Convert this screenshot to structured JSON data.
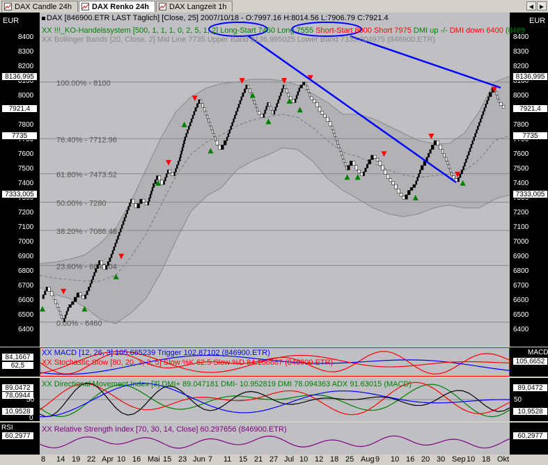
{
  "tabs": [
    {
      "label": "DAX Candle 24h",
      "active": false
    },
    {
      "label": "DAX Renko 24h",
      "active": true
    },
    {
      "label": "DAX Langzeit 1h",
      "active": false
    }
  ],
  "nav": {
    "left": "◀",
    "right": "▶"
  },
  "main": {
    "unit": "EUR",
    "header_line1": "DAX [846900.ETR LAST Täglich] [Close, 25] 2007/10/18 - O:7997.16 H:8014.56 L:7906.79 C:7921.4",
    "header_line2_a": "XX !!!_KO-Handelssystem [500, 1, 1, 1, 0, 2, 5, 1, 2]",
    "header_line2_long": "Long-Start 7450",
    "header_line2_long2": "Long 7555",
    "header_line2_short": "Short-Start 8000",
    "header_line2_short2": "Short 7975",
    "header_line2_dmiup": "DMI up -/-",
    "header_line2_dmidown": "DMI down 6400",
    "header_line2_end": "(8469",
    "header_line3": "XX Bollinger Bands [20, Close, 2] Mid Line 7735 Upper Band 8136.995025 Lower Band 7333.004975 (846900.ETR)",
    "right_boxes": [
      {
        "v": "8136,995",
        "y": 8137
      },
      {
        "v": "7921,4",
        "y": 7921
      },
      {
        "v": "7735",
        "y": 7735
      },
      {
        "v": "7333,005",
        "y": 7333
      }
    ],
    "left_boxes": [
      {
        "v": "8136,995",
        "y": 8137
      },
      {
        "v": "7921,4",
        "y": 7921
      },
      {
        "v": "7735",
        "y": 7735
      },
      {
        "v": "7333,005",
        "y": 7333
      }
    ]
  },
  "fib_levels": [
    {
      "label": "100.00% - 8100",
      "value": 8100
    },
    {
      "label": "76.40% - 7712.96",
      "value": 7712.96
    },
    {
      "label": "61.80% - 7473.52",
      "value": 7473.52
    },
    {
      "label": "50.00% - 7280",
      "value": 7280
    },
    {
      "label": "38.20% - 7086.48",
      "value": 7086.48
    },
    {
      "label": "23.60% - 6847.04",
      "value": 6847.04
    },
    {
      "label": "0.00% - 6460",
      "value": 6460
    }
  ],
  "macd": {
    "header1": "XX MACD [12, 26, 3] 105.665239 Trigger 102.87102 (846900.ETR)",
    "header2": "XX Stochastic Slow [80, 20, 3, 3, 5] Slow %K 62.5 Slow %D 84.166667 (846900.ETR)",
    "label": "MACD",
    "left1": "84,1667",
    "left2": "62,5",
    "right": "105,6652"
  },
  "dmi": {
    "header": "XX Directional Movement Index [3] DMI+ 89.047181 DMI- 10.952819 DMI 78.094363 ADX 91.63015 (MACD)",
    "left1": "89,0472",
    "left2": "78,0944",
    "left3": "50",
    "left4": "10,9528",
    "left5": "0",
    "right1": "89,0472",
    "right2": "50",
    "right3": "10,9528"
  },
  "rsi": {
    "header": "XX Relative Strength Index [70, 30, 14, Close] 60.297656 (846900.ETR)",
    "label": "RSI",
    "left": "60,2977",
    "right": "60,2977"
  },
  "x_labels": [
    "8",
    "14",
    "19",
    "22",
    "Apr",
    "10",
    "16",
    "Mai",
    "15",
    "23",
    "Jun",
    "7",
    "11",
    "15",
    "21",
    "27",
    "Jul",
    "10",
    "12",
    "18",
    "25",
    "Aug",
    "9",
    "10",
    "16",
    "20",
    "30",
    "Sep",
    "10",
    "18",
    "Okt"
  ],
  "colors": {
    "bg": "#c0c0c4",
    "band": "#b2b2b6",
    "up": "#000000",
    "down": "#ffffff",
    "long": "#008000",
    "short": "#ff0000",
    "annot": "#0000ff"
  },
  "chart_data": {
    "type": "line",
    "title": "DAX [846900.ETR LAST Täglich] Renko",
    "ylabel": "EUR",
    "ylim": [
      6340,
      8480
    ],
    "x_tick_labels": [
      "8",
      "14",
      "19",
      "22",
      "Apr",
      "10",
      "16",
      "Mai",
      "15",
      "23",
      "Jun",
      "7",
      "11",
      "15",
      "21",
      "27",
      "Jul",
      "10",
      "12",
      "18",
      "25",
      "Aug",
      "9",
      "10",
      "16",
      "20",
      "30",
      "Sep",
      "10",
      "18",
      "Okt"
    ],
    "y_ticks": [
      6400,
      6500,
      6600,
      6700,
      6800,
      6900,
      7000,
      7100,
      7200,
      7300,
      7400,
      7500,
      7600,
      7700,
      7800,
      7900,
      8000,
      8100,
      8200,
      8300,
      8400
    ],
    "close": 7921.4,
    "renko_path": [
      6620,
      6700,
      6640,
      6560,
      6460,
      6560,
      6600,
      6660,
      6620,
      6700,
      6800,
      6880,
      6820,
      6900,
      7000,
      7100,
      7200,
      7300,
      7240,
      7300,
      7260,
      7380,
      7460,
      7400,
      7500,
      7460,
      7560,
      7700,
      7800,
      7900,
      7980,
      7900,
      7800,
      7700,
      7640,
      7700,
      7800,
      7900,
      8000,
      8080,
      8000,
      7900,
      7860,
      7960,
      7880,
      7980,
      8080,
      8000,
      7960,
      8060,
      8100,
      8000,
      7960,
      7900,
      7860,
      7800,
      7700,
      7600,
      7500,
      7560,
      7500,
      7460,
      7540,
      7600,
      7560,
      7500,
      7440,
      7400,
      7340,
      7300,
      7360,
      7400,
      7500,
      7560,
      7640,
      7700,
      7640,
      7560,
      7460,
      7420,
      7500,
      7600,
      7700,
      7800,
      7900,
      8000,
      8060,
      7960,
      7921
    ],
    "bollinger_upper": [
      6860,
      6870,
      6890,
      6920,
      7000,
      7100,
      7280,
      7500,
      7720,
      7900,
      8000,
      8060,
      8090,
      8100,
      8120,
      8120,
      8110,
      8080,
      8020,
      7960,
      7880,
      7880,
      7850,
      7800,
      7750,
      7700,
      7680,
      7680,
      7750,
      7900,
      8100,
      8140
    ],
    "bollinger_lower": [
      6700,
      6650,
      6620,
      6560,
      6480,
      6450,
      6520,
      6620,
      6800,
      7020,
      7220,
      7320,
      7380,
      7500,
      7560,
      7600,
      7650,
      7640,
      7560,
      7440,
      7360,
      7300,
      7240,
      7200,
      7180,
      7200,
      7240,
      7260,
      7240,
      7240,
      7300,
      7330
    ],
    "bollinger_mid": [
      6780,
      6760,
      6750,
      6740,
      6740,
      6780,
      6900,
      7060,
      7260,
      7460,
      7610,
      7690,
      7740,
      7800,
      7840,
      7860,
      7880,
      7860,
      7790,
      7700,
      7620,
      7590,
      7545,
      7500,
      7465,
      7450,
      7460,
      7470,
      7495,
      7570,
      7700,
      7735
    ],
    "long_signals": [
      {
        "i": 0,
        "y": 6580
      },
      {
        "i": 8,
        "y": 6580
      },
      {
        "i": 14,
        "y": 6800
      },
      {
        "i": 22,
        "y": 7440
      },
      {
        "i": 27,
        "y": 7840
      },
      {
        "i": 32,
        "y": 7660
      },
      {
        "i": 40,
        "y": 8040
      },
      {
        "i": 43,
        "y": 7860
      },
      {
        "i": 47,
        "y": 8000
      },
      {
        "i": 49,
        "y": 7940
      },
      {
        "i": 58,
        "y": 7480
      },
      {
        "i": 60,
        "y": 7480
      },
      {
        "i": 71,
        "y": 7340
      },
      {
        "i": 80,
        "y": 7440
      }
    ],
    "short_signals": [
      {
        "i": 4,
        "y": 6640
      },
      {
        "i": 15,
        "y": 6880
      },
      {
        "i": 24,
        "y": 7520
      },
      {
        "i": 29,
        "y": 7960
      },
      {
        "i": 38,
        "y": 8080
      },
      {
        "i": 46,
        "y": 8080
      },
      {
        "i": 51,
        "y": 8100
      },
      {
        "i": 65,
        "y": 7580
      },
      {
        "i": 74,
        "y": 7700
      },
      {
        "i": 79,
        "y": 7440
      },
      {
        "i": 86,
        "y": 8020
      }
    ],
    "annotations": [
      "Long-Start 7450",
      "Short-Start 8000"
    ]
  }
}
